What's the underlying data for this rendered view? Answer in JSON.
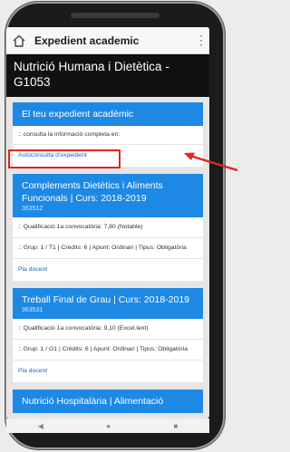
{
  "appbar": {
    "title": "Expedient academic",
    "menu_glyph": "⋮"
  },
  "course_header": {
    "title": "Nutrició Humana i Dietètica - G1053"
  },
  "expedient_card": {
    "title": "El teu expedient acadèmic",
    "info_text": ":: consulta la informació completa en:",
    "link_label": "Autoconsulta d'expedient"
  },
  "courses": [
    {
      "title": "Complements Dietètics i Aliments Funcionals | Curs: 2018-2019",
      "code": "363512",
      "grade": ":: Qualificació 1a convocatòria: 7,80 (Notable)",
      "details": ":: Grup: 1 / T1 | Crèdits: 6 | Apunt: Ordinari | Tipus: Obligatòria",
      "link": "Pla docent"
    },
    {
      "title": "Treball Final de Grau | Curs: 2018-2019",
      "code": "363531",
      "grade": ":: Qualificació 1a convocatòria: 9,10 (Excel.lent)",
      "details": ":: Grup: 1 / G1 | Crèdits: 6 | Apunt: Ordinari | Tipus: Obligatòria",
      "link": "Pla docent"
    },
    {
      "title": "Nutrició Hospitalària | Alimentació"
    }
  ],
  "navbar": {
    "back": "◀",
    "home": "●",
    "recent": "■"
  },
  "colors": {
    "accent": "#1e88e5",
    "link": "#1565c0",
    "highlight": "#e22424",
    "header_bg": "#111111"
  }
}
